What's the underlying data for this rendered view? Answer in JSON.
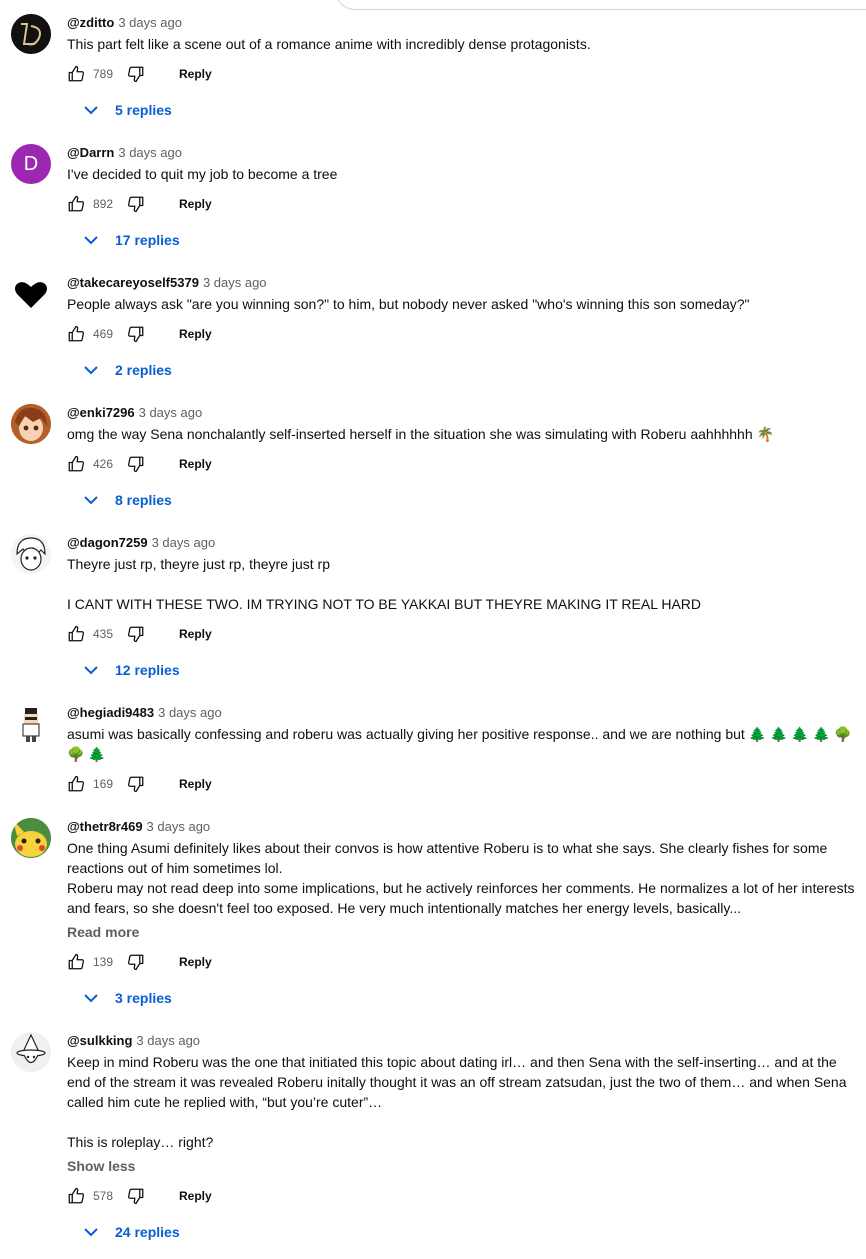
{
  "comments": [
    {
      "author": "@zditto",
      "time": "3 days ago",
      "text": "This part felt like a scene out of a romance anime with incredibly dense protagonists.",
      "likes": "789",
      "reply": "Reply",
      "replies": "5 replies",
      "avatar": {
        "type": "logo",
        "bg": "#111111",
        "letter": "D"
      }
    },
    {
      "author": "@Darrn",
      "time": "3 days ago",
      "text": "I've decided to quit my job to become a tree",
      "likes": "892",
      "reply": "Reply",
      "replies": "17 replies",
      "avatar": {
        "type": "letter",
        "bg": "#9c27b0",
        "letter": "D"
      }
    },
    {
      "author": "@takecareyoself5379",
      "time": "3 days ago",
      "text": "People always ask \"are you winning son?\" to him, but nobody never asked \"who's winning this son someday?\"",
      "likes": "469",
      "reply": "Reply",
      "replies": "2 replies",
      "avatar": {
        "type": "heart",
        "bg": "#ffffff"
      }
    },
    {
      "author": "@enki7296",
      "time": "3 days ago",
      "text": "omg the way Sena nonchalantly self-inserted herself in the situation she was simulating with Roberu aahhhhhh 🌴",
      "likes": "426",
      "reply": "Reply",
      "replies": "8 replies",
      "avatar": {
        "type": "anime",
        "bg": "#c7763b"
      }
    },
    {
      "author": "@dagon7259",
      "time": "3 days ago",
      "text": "Theyre just rp, theyre just rp, theyre just rp\n\nI CANT WITH THESE TWO. IM TRYING NOT TO BE YAKKAI BUT THEYRE MAKING IT REAL HARD",
      "likes": "435",
      "reply": "Reply",
      "replies": "12 replies",
      "avatar": {
        "type": "sketch",
        "bg": "#f2f2f2"
      }
    },
    {
      "author": "@hegiadi9483",
      "time": "3 days ago",
      "text": "asumi was basically confessing and roberu was actually giving her positive response.. and we are nothing but 🌲 🌲 🌲 🌲 🌳 🌳 🌲",
      "likes": "169",
      "reply": "Reply",
      "replies": "",
      "avatar": {
        "type": "pixel",
        "bg": "#ffffff"
      }
    },
    {
      "author": "@thetr8r469",
      "time": "3 days ago",
      "text": "One thing Asumi definitely likes about their convos is how attentive Roberu is to what she says. She clearly fishes for some reactions out of him sometimes lol.\nRoberu may not read deep into some implications, but he actively reinforces her comments. He normalizes a lot of her interests and fears, so she doesn't feel too exposed. He very much intentionally matches her energy levels, basically...",
      "more": "Read more",
      "likes": "139",
      "reply": "Reply",
      "replies": "3 replies",
      "avatar": {
        "type": "pika",
        "bg": "#3f8f5a"
      }
    },
    {
      "author": "@sulkking",
      "time": "3 days ago",
      "text": "Keep in mind Roberu was the one that initiated this topic about dating irl… and then Sena with the self-inserting… and at the end of the stream it was revealed Roberu initally thought it was an off stream zatsudan, just the two of them… and when Sena called him cute he replied with, “but you’re cuter”…\n\nThis is roleplay… right?",
      "more": "Show less",
      "likes": "578",
      "reply": "Reply",
      "replies": "24 replies",
      "avatar": {
        "type": "wizard",
        "bg": "#eeeeee"
      }
    }
  ]
}
